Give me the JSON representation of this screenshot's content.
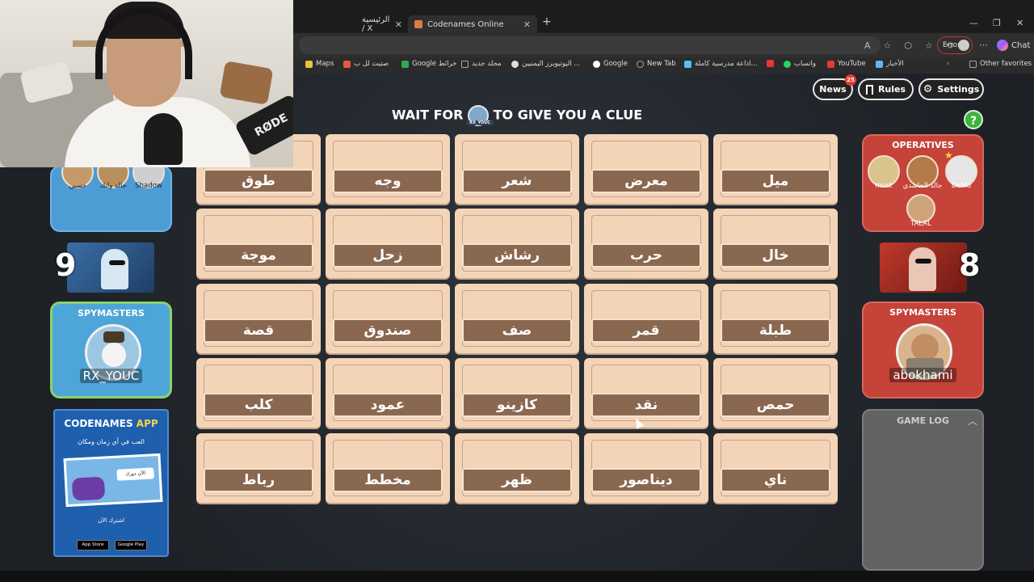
{
  "browser": {
    "tabs": [
      {
        "label": "الرئيسية / X",
        "active": false
      },
      {
        "label": "Codenames Online",
        "active": true
      }
    ],
    "error_label": "Error",
    "chat_label": "Chat",
    "bookmarks": [
      {
        "label": "Maps",
        "color": "#e9c43a"
      },
      {
        "label": "صتيت لل ب",
        "color": "#e9573f"
      },
      {
        "label": "Google خرائط",
        "color": "#34a853"
      },
      {
        "label": "مجلد جديد",
        "color": "#888888"
      },
      {
        "label": "اليوتيوبرز اليمنيين ...",
        "color": "#dddddd"
      },
      {
        "label": "Google",
        "color": "#ffffff"
      },
      {
        "label": "New Tab",
        "color": "#aaaaaa"
      },
      {
        "label": "اذاعة مدرسية كاملة...",
        "color": "#4fc3f7"
      },
      {
        "label": "",
        "color": "#e53935"
      },
      {
        "label": "واتساب",
        "color": "#25d366"
      },
      {
        "label": "YouTube",
        "color": "#e53935"
      },
      {
        "label": "الأخبار",
        "color": "#64b5f6"
      },
      {
        "label": "Other favorites",
        "color": "#999999"
      }
    ]
  },
  "game": {
    "clue_prompt_before": "WAIT FOR",
    "clue_prompt_after": "TO GIVE YOU A CLUE",
    "clue_giver_tag": "RX_YOUC",
    "buttons": {
      "news": "News",
      "news_badge": "25",
      "rules": "Rules",
      "settings": "Settings"
    },
    "help_label": "?",
    "cards": [
      [
        "طوق",
        "وجه",
        "شعر",
        "معرض",
        "ميل"
      ],
      [
        "موجة",
        "زحل",
        "رشاش",
        "حرب",
        "خال"
      ],
      [
        "قصة",
        "صندوق",
        "صف",
        "قمر",
        "طبلة"
      ],
      [
        "كلب",
        "عمود",
        "كازينو",
        "نقد",
        "حمص"
      ],
      [
        "رباط",
        "مخطط",
        "ظهر",
        "ديناصور",
        "ناي"
      ]
    ],
    "blue_team": {
      "operatives": [
        "حسين",
        "جالد وانك",
        "Shadow"
      ],
      "score": "9",
      "spymasters_title": "SPYMASTERS",
      "spymaster": "RX_YOUC"
    },
    "red_team": {
      "operatives_title": "OPERATIVES",
      "operatives": [
        "must",
        "جالد الحاشدي",
        "DeMo",
        "TALAL"
      ],
      "score": "8",
      "spymasters_title": "SPYMASTERS",
      "spymaster": "abokhami"
    },
    "app_ad": {
      "title_prefix": "CODENAMES",
      "title_suffix": "APP",
      "tagline": "العب في أي زمان ومكان",
      "bubble": "الآن دورك",
      "cta": "اشترك الآن",
      "app_store": "App Store",
      "google_play": "Google Play"
    },
    "game_log_title": "GAME LOG"
  },
  "webcam": {
    "mic_brand": "RØDE"
  }
}
